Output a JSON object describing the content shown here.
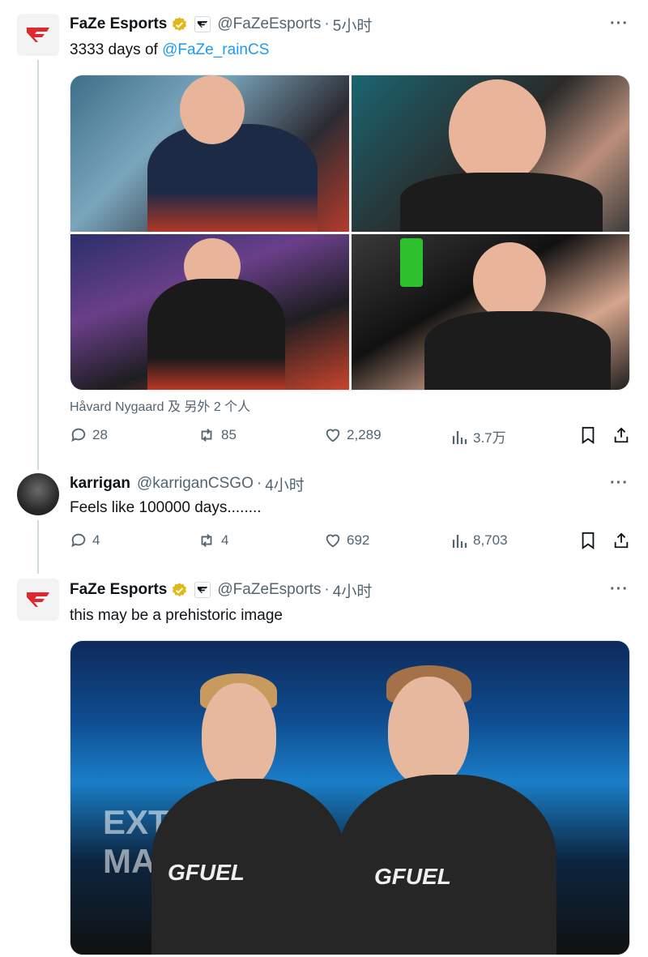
{
  "tweets": [
    {
      "name": "FaZe Esports",
      "handle": "@FaZeEsports",
      "time": "5小时",
      "text_prefix": "3333 days of ",
      "mention": "@FaZe_rainCS",
      "tagged": "Håvard Nygaard 及 另外 2 个人",
      "replies": "28",
      "retweets": "85",
      "likes": "2,289",
      "views": "3.7万"
    },
    {
      "name": "karrigan",
      "handle": "@karriganCSGO",
      "time": "4小时",
      "text": "Feels like 100000 days........",
      "replies": "4",
      "retweets": "4",
      "likes": "692",
      "views": "8,703"
    },
    {
      "name": "FaZe Esports",
      "handle": "@FaZeEsports",
      "time": "4小时",
      "text": "this may be a prehistoric image"
    }
  ],
  "separator": "·",
  "more_glyph": "···",
  "media_text": {
    "stage": "EXTR",
    "stage2": "MAS",
    "shirt": "GFUEL"
  },
  "colors": {
    "accent": "#1d9bf0",
    "verified": "#e2b719",
    "faze_red": "#e0262f",
    "secondary": "#536471"
  },
  "icons": [
    "faze-logo-icon",
    "verified-badge-icon",
    "affiliate-icon",
    "more-icon",
    "reply-icon",
    "retweet-icon",
    "like-icon",
    "views-icon",
    "bookmark-icon",
    "share-icon"
  ]
}
